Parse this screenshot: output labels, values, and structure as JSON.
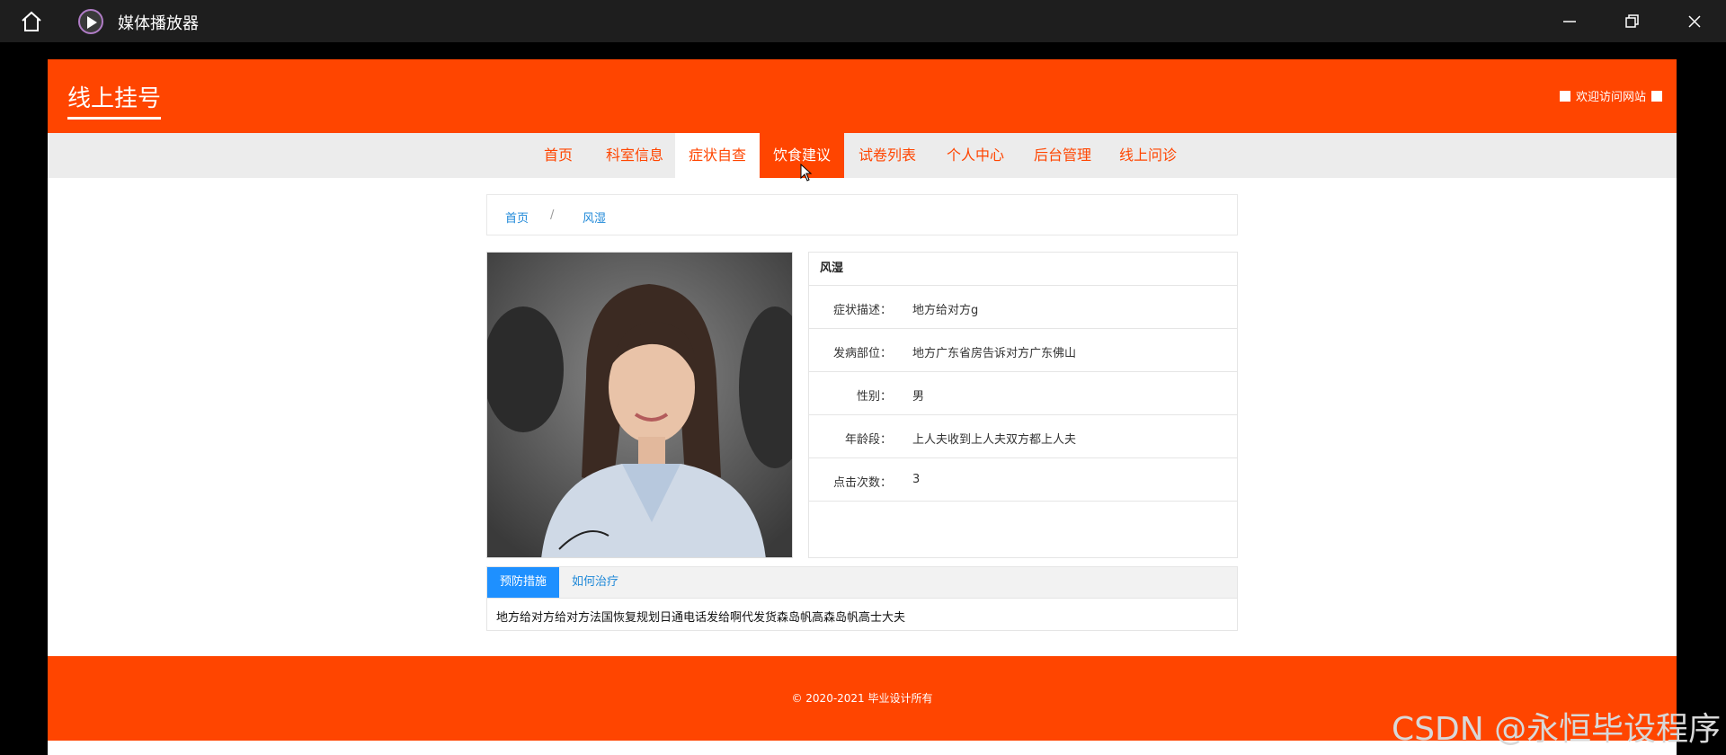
{
  "window": {
    "title": "媒体播放器"
  },
  "header": {
    "site_title": "线上挂号",
    "welcome": "欢迎访问网站"
  },
  "nav": {
    "items": [
      {
        "label": "首页"
      },
      {
        "label": "科室信息"
      },
      {
        "label": "症状自查"
      },
      {
        "label": "饮食建议"
      },
      {
        "label": "试卷列表"
      },
      {
        "label": "个人中心"
      },
      {
        "label": "后台管理"
      },
      {
        "label": "线上问诊"
      }
    ],
    "active": "饮食建议",
    "hovered": "症状自查"
  },
  "breadcrumb": {
    "home": "首页",
    "sep": "/",
    "current": "风湿"
  },
  "detail": {
    "title": "风湿",
    "rows": [
      {
        "label": "症状描述：",
        "value": "地方给对方g"
      },
      {
        "label": "发病部位：",
        "value": "地方广东省房告诉对方广东佛山"
      },
      {
        "label": "性别：",
        "value": "男"
      },
      {
        "label": "年龄段：",
        "value": "上人夫收到上人夫双方都上人夫"
      },
      {
        "label": "点击次数：",
        "value": "3"
      }
    ]
  },
  "tabs": {
    "items": [
      {
        "label": "预防措施"
      },
      {
        "label": "如何治疗"
      }
    ],
    "content": "地方给对方给对方法国恢复规划日通电话发给啊代发货森岛帆高森岛帆高士大夫"
  },
  "footer": {
    "copyright": "© 2020-2021 毕业设计所有"
  },
  "watermark": "CSDN @永恒毕设程序",
  "colors": {
    "brand": "#ff4500",
    "link": "#1e88d8",
    "tab_active": "#1e90ff"
  }
}
